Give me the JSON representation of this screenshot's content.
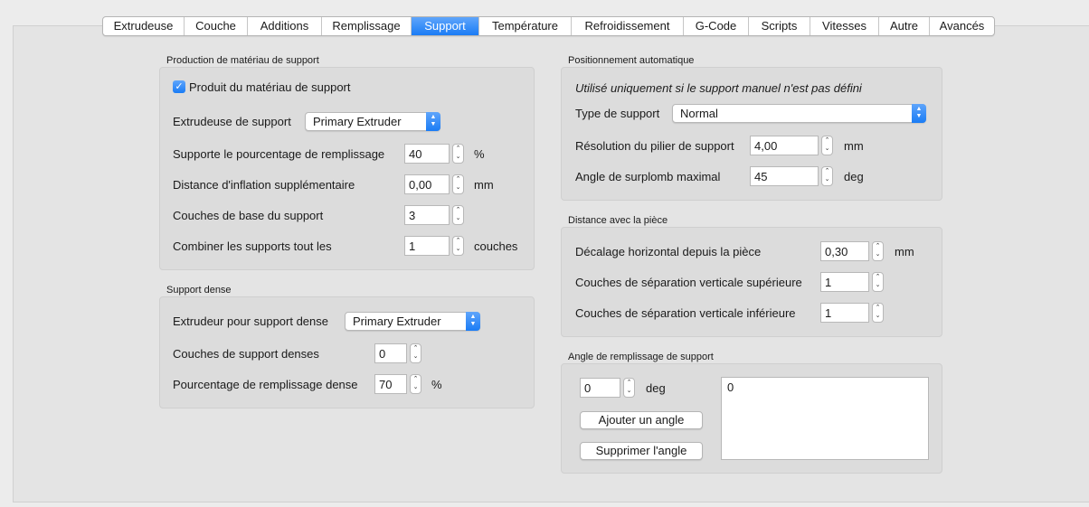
{
  "tabs": [
    "Extrudeuse",
    "Couche",
    "Additions",
    "Remplissage",
    "Support",
    "Température",
    "Refroidissement",
    "G-Code",
    "Scripts",
    "Vitesses",
    "Autre",
    "Avancés"
  ],
  "active_tab": "Support",
  "support_material": {
    "title": "Production de matériau de support",
    "generate_label": "Produit du matériau de support",
    "generate_checked": true,
    "extruder_label": "Extrudeuse de support",
    "extruder_value": "Primary Extruder",
    "infill_pct_label": "Supporte le pourcentage de remplissage",
    "infill_pct_value": "40",
    "infill_pct_unit": "%",
    "inflation_label": "Distance d'inflation supplémentaire",
    "inflation_value": "0,00",
    "inflation_unit": "mm",
    "base_layers_label": "Couches de base du support",
    "base_layers_value": "3",
    "combine_label": "Combiner les supports tout les",
    "combine_value": "1",
    "combine_unit": "couches"
  },
  "dense_support": {
    "title": "Support dense",
    "extruder_label": "Extrudeur pour support dense",
    "extruder_value": "Primary Extruder",
    "layers_label": "Couches de support denses",
    "layers_value": "0",
    "infill_label": "Pourcentage de remplissage dense",
    "infill_value": "70",
    "infill_unit": "%"
  },
  "auto_placement": {
    "title": "Positionnement automatique",
    "note": "Utilisé uniquement si le support manuel n'est pas défini",
    "type_label": "Type de support",
    "type_value": "Normal",
    "pillar_label": "Résolution du pilier de support",
    "pillar_value": "4,00",
    "pillar_unit": "mm",
    "overhang_label": "Angle de surplomb maximal",
    "overhang_value": "45",
    "overhang_unit": "deg"
  },
  "part_distance": {
    "title": "Distance avec la pièce",
    "horizontal_label": "Décalage horizontal depuis la pièce",
    "horizontal_value": "0,30",
    "horizontal_unit": "mm",
    "upper_label": "Couches de séparation verticale supérieure",
    "upper_value": "1",
    "lower_label": "Couches de séparation verticale inférieure",
    "lower_value": "1"
  },
  "infill_angle": {
    "title": "Angle de remplissage de support",
    "angle_value": "0",
    "angle_unit": "deg",
    "add_button": "Ajouter un angle",
    "remove_button": "Supprimer l'angle",
    "angles": [
      "0"
    ]
  },
  "colors": {
    "accent": "#1a7cf5"
  }
}
